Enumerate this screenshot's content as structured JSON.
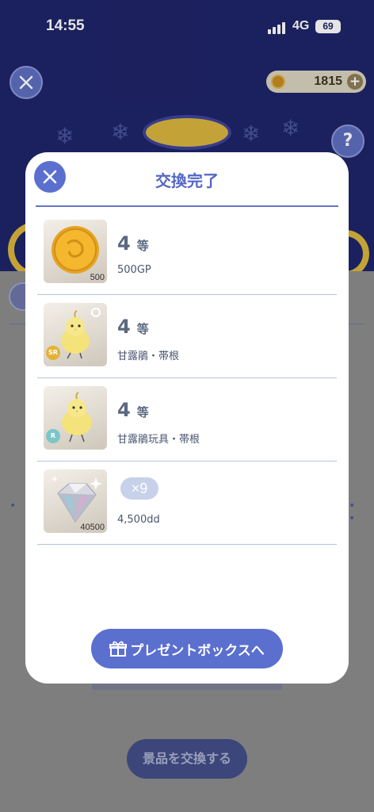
{
  "status_bar": {
    "time": "14:55",
    "network": "4G",
    "battery": "69"
  },
  "header": {
    "coin_balance": "1815",
    "help_label": "?"
  },
  "background_page": {
    "exchange_button_label": "景品を交換する"
  },
  "modal": {
    "title": "交換完了",
    "items": [
      {
        "rank": "4",
        "rank_unit": "等",
        "name": "500GP",
        "thumb_count": "500",
        "rarity": "",
        "icon": "gold-coin-icon"
      },
      {
        "rank": "4",
        "rank_unit": "等",
        "name": "甘露鵑・帯根",
        "thumb_count": "",
        "rarity": "SR",
        "icon": "chick-icon"
      },
      {
        "rank": "4",
        "rank_unit": "等",
        "name": "甘露鵑玩具・帯根",
        "thumb_count": "",
        "rarity": "R",
        "icon": "chick-toy-icon"
      }
    ],
    "dd_item": {
      "quantity": "×9",
      "name": "4,500dd",
      "thumb_count": "40500",
      "icon": "diamond-icon"
    },
    "gift_button_label": "プレゼントボックスへ"
  },
  "colors": {
    "accent": "#5b6fcf",
    "title": "#5467c4",
    "background": "#1a2066",
    "rarity_sr": "#e3b236",
    "rarity_r": "#7bc6c9"
  }
}
